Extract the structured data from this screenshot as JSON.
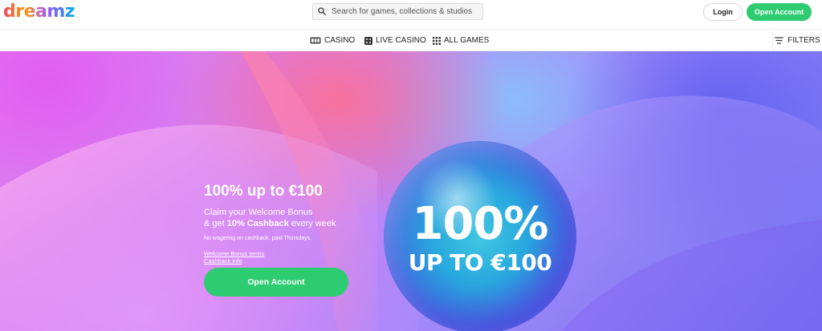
{
  "header": {
    "logo_text": "dreamz",
    "search": {
      "placeholder": "Search for games, collections & studios",
      "value": ""
    },
    "login_label": "Login",
    "open_account_label": "Open Account"
  },
  "nav": {
    "items": [
      {
        "label": "CASINO",
        "icon": "slot-machine-icon"
      },
      {
        "label": "LIVE CASINO",
        "icon": "dice-icon"
      },
      {
        "label": "ALL GAMES",
        "icon": "grid-icon"
      }
    ],
    "filters_label": "FILTERS"
  },
  "hero": {
    "title": "100% up to €100",
    "line1": "Claim your Welcome Bonus",
    "line2_prefix": "& get ",
    "line2_bold": "10% Cashback",
    "line2_suffix": " every week",
    "note": "No wagering on cashback, paid Thursdays.",
    "link_terms": "Welcome Bonus terms",
    "link_cashback": "Cashback info",
    "cta_label": "Open Account",
    "banner_big": "100%",
    "banner_sub": "UP TO €100"
  },
  "colors": {
    "accent_green": "#2ecc71"
  }
}
